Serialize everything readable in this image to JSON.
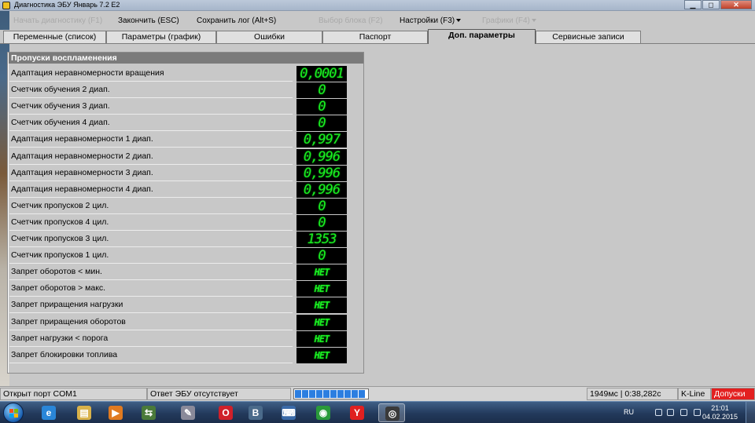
{
  "window": {
    "title": "Диагностика ЭБУ Январь 7.2 Е2",
    "buttons": [
      "minimize",
      "maximize",
      "close"
    ]
  },
  "menu": [
    {
      "label": "Начать диагностику (F1)",
      "enabled": false
    },
    {
      "label": "Закончить (ESC)",
      "enabled": true
    },
    {
      "label": "Сохранить лог (Alt+S)",
      "enabled": true
    },
    {
      "label": "Выбор блока (F2)",
      "enabled": false
    },
    {
      "label": "Настройки (F3)",
      "enabled": true,
      "dropdown": true
    },
    {
      "label": "Графики (F4)",
      "enabled": false,
      "dropdown": true
    }
  ],
  "tabs": [
    {
      "label": "Переменные (список)",
      "active": false
    },
    {
      "label": "Параметры (график)",
      "active": false
    },
    {
      "label": "Ошибки",
      "active": false
    },
    {
      "label": "Паспорт",
      "active": false
    },
    {
      "label": "Доп. параметры",
      "active": true
    },
    {
      "label": "Сервисные записи",
      "active": false
    }
  ],
  "panel": {
    "title": "Пропуски воспламенения",
    "rows": [
      {
        "label": "Адаптация неравномерности вращения",
        "value": "0,0001"
      },
      {
        "label": "Счетчик обучения 2 диап.",
        "value": "0"
      },
      {
        "label": "Счетчик обучения 3 диап.",
        "value": "0"
      },
      {
        "label": "Счетчик обучения 4 диап.",
        "value": "0"
      },
      {
        "label": "Адаптация неравномерности 1 диап.",
        "value": "0,997"
      },
      {
        "label": "Адаптация неравномерности 2 диап.",
        "value": "0,996"
      },
      {
        "label": "Адаптация неравномерности 3 диап.",
        "value": "0,996"
      },
      {
        "label": "Адаптация неравномерности 4 диап.",
        "value": "0,996"
      },
      {
        "label": "Счетчик пропусков 2 цил.",
        "value": "0"
      },
      {
        "label": "Счетчик пропусков 4 цил.",
        "value": "0"
      },
      {
        "label": "Счетчик пропусков 3 цил.",
        "value": "1353"
      },
      {
        "label": "Счетчик пропусков 1 цил.",
        "value": "0"
      },
      {
        "label": "Запрет оборотов < мин.",
        "value": "НЕТ"
      },
      {
        "label": "Запрет оборотов > макс.",
        "value": "НЕТ"
      },
      {
        "label": "Запрет приращения нагрузки",
        "value": "НЕТ"
      },
      {
        "label": "Запрет приращения оборотов",
        "value": "НЕТ"
      },
      {
        "label": "Запрет нагрузки < порога",
        "value": "НЕТ"
      },
      {
        "label": "Запрет блокировки топлива",
        "value": "НЕТ"
      }
    ],
    "value_color": "#19f021"
  },
  "status": {
    "port": "Открыт порт COM1",
    "ecu": "Ответ ЭБУ отсутствует",
    "progress_segments": 10,
    "timing": "1949мс | 0:38,282с",
    "protocol": "K-Line",
    "alert": "Допуски",
    "alert_color": "#e32020"
  },
  "taskbar": {
    "apps": [
      {
        "name": "ie-icon",
        "glyph": "e",
        "color": "#2a86d8"
      },
      {
        "name": "explorer-icon",
        "glyph": "▤",
        "color": "#d9b24a"
      },
      {
        "name": "media-player-icon",
        "glyph": "▶",
        "color": "#e07a20"
      },
      {
        "name": "network-app-icon",
        "glyph": "⇆",
        "color": "#4a7a3a"
      },
      {
        "name": "tool-app-icon",
        "glyph": "✎",
        "color": "#8a8a9a"
      },
      {
        "name": "opera-icon",
        "glyph": "O",
        "color": "#d0202a"
      },
      {
        "name": "vk-icon",
        "glyph": "В",
        "color": "#4a6a8a"
      },
      {
        "name": "keyboard-app-icon",
        "glyph": "⌨",
        "color": "#3a6aa8"
      },
      {
        "name": "chrome-icon",
        "glyph": "◉",
        "color": "#2a9a3a"
      },
      {
        "name": "yandex-icon",
        "glyph": "Y",
        "color": "#e02020"
      },
      {
        "name": "diagnostics-app-icon",
        "glyph": "◎",
        "color": "#3a3a3a",
        "active": true
      }
    ],
    "language": "RU",
    "time": "21:01",
    "date": "04.02.2015"
  }
}
